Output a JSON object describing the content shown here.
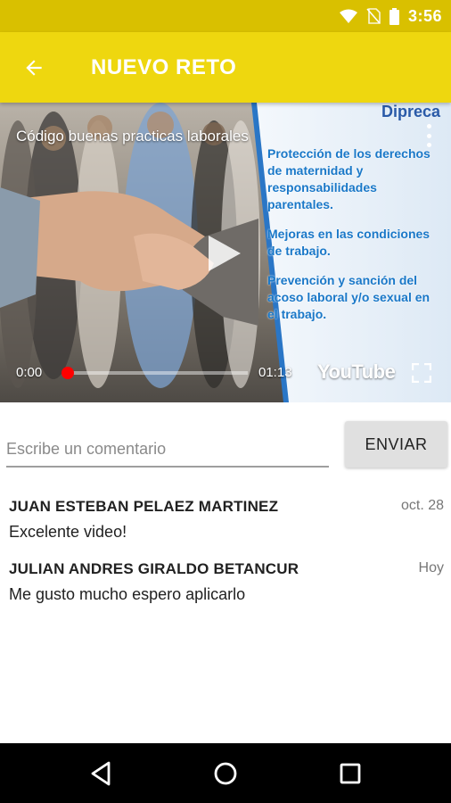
{
  "status_bar": {
    "time": "3:56",
    "icons": [
      "wifi-icon",
      "no-sim-icon",
      "battery-icon"
    ]
  },
  "app_bar": {
    "title": "NUEVO RETO",
    "back_icon": "arrow-back-icon"
  },
  "video": {
    "title": "Código buenas practicas laborales",
    "brand": "Dipreca",
    "slide_lines": [
      "Protección de los derechos de maternidad y responsabilidades parentales.",
      "Mejoras en las condiciones de trabajo.",
      "Prevención y sanción del acoso laboral y/o sexual en el trabajo."
    ],
    "current_time": "0:00",
    "total_time": "01:13",
    "progress": 0.02,
    "provider": "YouTube"
  },
  "comment_form": {
    "placeholder": "Escribe un comentario",
    "value": "",
    "send_label": "ENVIAR"
  },
  "comments": [
    {
      "author": "JUAN ESTEBAN PELAEZ MARTINEZ",
      "date": "oct. 28",
      "text": "Excelente video!"
    },
    {
      "author": "JULIAN ANDRES GIRALDO BETANCUR",
      "date": "Hoy",
      "text": "Me gusto mucho espero aplicarlo"
    }
  ],
  "colors": {
    "status_bar": "#d9c000",
    "app_bar": "#eed70f",
    "progress": "#ff0000",
    "slide_text": "#1a78c8"
  }
}
